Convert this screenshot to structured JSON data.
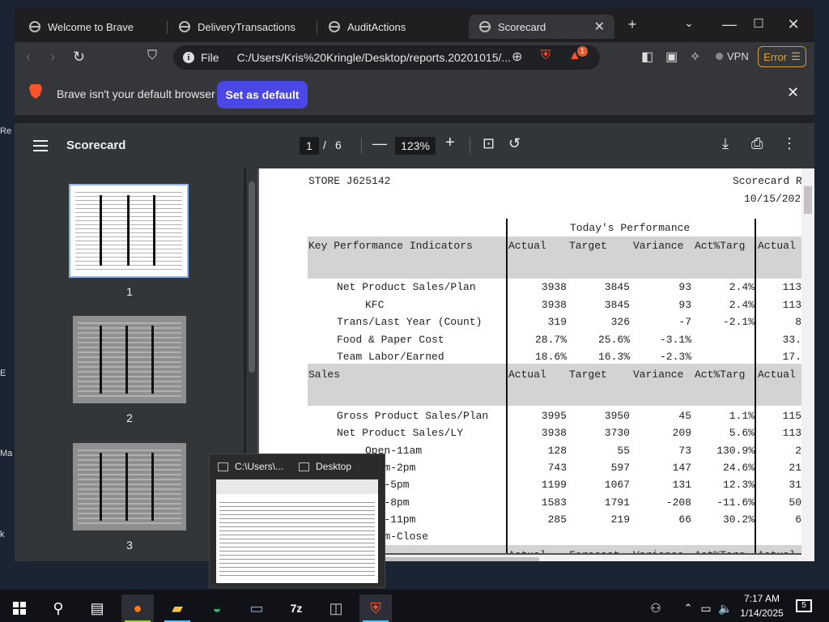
{
  "browser": {
    "tabs": [
      {
        "label": "Welcome to Brave"
      },
      {
        "label": "DeliveryTransactions"
      },
      {
        "label": "AuditActions"
      },
      {
        "label": "Scorecard",
        "active": true
      }
    ],
    "url": {
      "scheme_label": "File",
      "path": "C:/Users/Kris%20Kringle/Desktop/reports.20201015/..."
    },
    "vpn_label": "VPN",
    "error_label": "Error",
    "rewards_badge": "1"
  },
  "infobar": {
    "message": "Brave isn't your default browser",
    "button": "Set as default"
  },
  "pdf": {
    "title": "Scorecard",
    "current_page": "1",
    "page_sep": "/",
    "total_pages": "6",
    "zoom": "123%",
    "thumbnails": [
      "1",
      "2",
      "3"
    ]
  },
  "document": {
    "store": "STORE J625142",
    "report_title": "Scorecard R",
    "date": "10/15/202",
    "todays_performance": "Today's Performance",
    "kpi": {
      "heading": "Key Performance Indicators",
      "columns": [
        "Actual",
        "Target",
        "Variance",
        "Act%Targ",
        "Actual"
      ],
      "rows": [
        {
          "label": "Net Product Sales/Plan",
          "indent": 1,
          "values": [
            "3938",
            "3845",
            "93",
            "2.4%",
            "113"
          ]
        },
        {
          "label": "KFC",
          "indent": 2,
          "values": [
            "3938",
            "3845",
            "93",
            "2.4%",
            "113"
          ]
        },
        {
          "label": "Trans/Last Year (Count)",
          "indent": 1,
          "values": [
            "319",
            "326",
            "-7",
            "-2.1%",
            "8"
          ]
        },
        {
          "label": "Food & Paper Cost",
          "indent": 1,
          "values": [
            "28.7%",
            "25.6%",
            "-3.1%",
            "",
            "33."
          ]
        },
        {
          "label": "Team Labor/Earned",
          "indent": 1,
          "values": [
            "18.6%",
            "16.3%",
            "-2.3%",
            "",
            "17."
          ]
        }
      ]
    },
    "sales": {
      "heading": "Sales",
      "columns": [
        "Actual",
        "Target",
        "Variance",
        "Act%Targ",
        "Actual"
      ],
      "rows": [
        {
          "label": "Gross Product Sales/Plan",
          "indent": 1,
          "values": [
            "3995",
            "3950",
            "45",
            "1.1%",
            "115"
          ]
        },
        {
          "label": "Net Product Sales/LY",
          "indent": 1,
          "values": [
            "3938",
            "3730",
            "209",
            "5.6%",
            "113"
          ]
        },
        {
          "label": "Open-11am",
          "indent": 2,
          "values": [
            "128",
            "55",
            "73",
            "130.9%",
            "2"
          ]
        },
        {
          "label": "11am-2pm",
          "indent": 2,
          "values": [
            "743",
            "597",
            "147",
            "24.6%",
            "21"
          ]
        },
        {
          "label": "2pm-5pm",
          "indent": 2,
          "values": [
            "1199",
            "1067",
            "131",
            "12.3%",
            "31"
          ]
        },
        {
          "label": "5pm-8pm",
          "indent": 2,
          "values": [
            "1583",
            "1791",
            "-208",
            "-11.6%",
            "50"
          ]
        },
        {
          "label": "8pm-11pm",
          "indent": 2,
          "values": [
            "285",
            "219",
            "66",
            "30.2%",
            "6"
          ]
        },
        {
          "label": "11pm-Close",
          "indent": 2,
          "values": [
            "",
            "",
            "",
            "",
            ""
          ]
        }
      ]
    },
    "next_section": {
      "heading": "Sales",
      "columns": [
        "Actual",
        "Forecast",
        "Variance",
        "Act%Targ",
        "Actual"
      ]
    }
  },
  "preview": {
    "items": [
      {
        "label": "C:\\Users\\..."
      },
      {
        "label": "Desktop"
      }
    ]
  },
  "taskbar": {
    "time": "7:17 AM",
    "date": "1/14/2025",
    "notifications": "5"
  },
  "desktop_labels": [
    "Re",
    "E",
    "Ma",
    "k"
  ],
  "colors": {
    "brave_orange": "#fb542b",
    "set_default_button": "#4a47e6",
    "error_outline": "#d49a2a",
    "thumb_selected_border": "#8ab4f8"
  }
}
